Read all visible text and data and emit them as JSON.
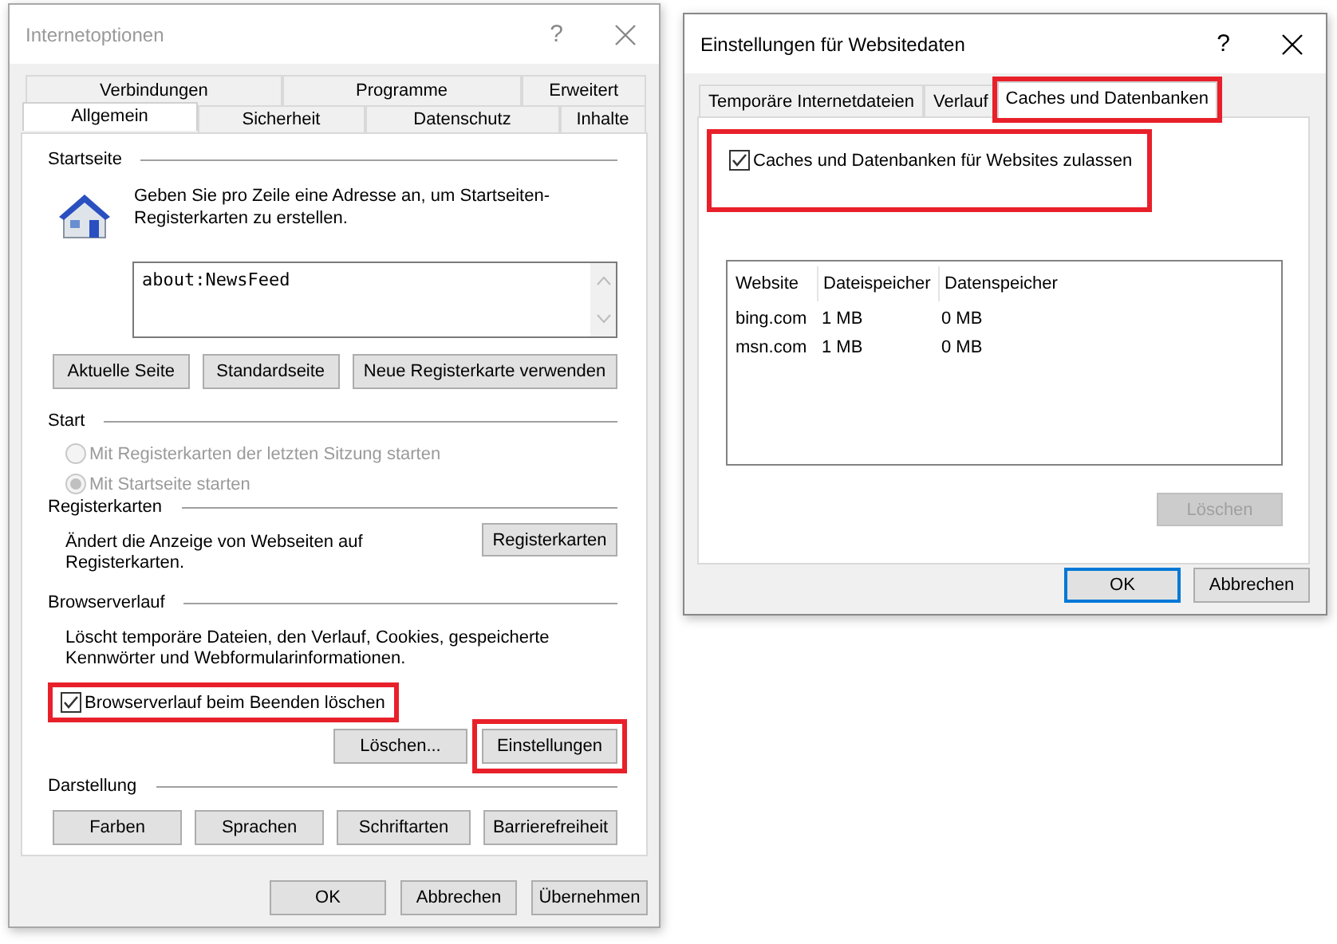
{
  "internet_options": {
    "title": "Internetoptionen",
    "help": "?",
    "tab_rows": [
      [
        {
          "label": "Verbindungen",
          "selected": false
        },
        {
          "label": "Programme",
          "selected": false
        },
        {
          "label": "Erweitert",
          "selected": false
        }
      ],
      [
        {
          "label": "Allgemein",
          "selected": true
        },
        {
          "label": "Sicherheit",
          "selected": false
        },
        {
          "label": "Datenschutz",
          "selected": false
        },
        {
          "label": "Inhalte",
          "selected": false
        }
      ]
    ],
    "startseite": {
      "heading": "Startseite",
      "description": "Geben Sie pro Zeile eine Adresse an, um Startseiten-Registerkarten zu erstellen.",
      "addresses": "about:NewsFeed",
      "buttons": [
        {
          "label": "Aktuelle Seite"
        },
        {
          "label": "Standardseite"
        },
        {
          "label": "Neue Registerkarte verwenden"
        }
      ]
    },
    "start": {
      "heading": "Start",
      "options": [
        {
          "label": "Mit Registerkarten der letzten Sitzung starten",
          "selected": false,
          "disabled": true
        },
        {
          "label": "Mit Startseite starten",
          "selected": true,
          "disabled": true
        }
      ]
    },
    "registerkarten": {
      "heading": "Registerkarten",
      "description": "Ändert die Anzeige von Webseiten auf Registerkarten.",
      "button": "Registerkarten"
    },
    "browserverlauf": {
      "heading": "Browserverlauf",
      "description": "Löscht temporäre Dateien, den Verlauf, Cookies, gespeicherte Kennwörter und Webformularinformationen.",
      "checkbox": {
        "label": "Browserverlauf beim Beenden löschen",
        "checked": true,
        "highlighted": true
      },
      "buttons": [
        {
          "label": "Löschen...",
          "highlighted": false
        },
        {
          "label": "Einstellungen",
          "highlighted": true
        }
      ]
    },
    "darstellung": {
      "heading": "Darstellung",
      "buttons": [
        {
          "label": "Farben"
        },
        {
          "label": "Sprachen"
        },
        {
          "label": "Schriftarten"
        },
        {
          "label": "Barrierefreiheit"
        }
      ]
    },
    "footer_buttons": [
      {
        "label": "OK",
        "default": false
      },
      {
        "label": "Abbrechen",
        "default": false
      },
      {
        "label": "Übernehmen",
        "default": false
      }
    ]
  },
  "website_data": {
    "title": "Einstellungen für Websitedaten",
    "help": "?",
    "tabs": [
      {
        "label": "Temporäre Internetdateien",
        "selected": false,
        "highlighted": false
      },
      {
        "label": "Verlauf",
        "selected": false,
        "highlighted": false
      },
      {
        "label": "Caches und Datenbanken",
        "selected": true,
        "highlighted": true
      }
    ],
    "checkbox": {
      "label": "Caches und Datenbanken für Websites zulassen",
      "checked": true,
      "highlighted": true
    },
    "table": {
      "columns": [
        "Website",
        "Dateispeicher",
        "Datenspeicher"
      ],
      "rows": [
        [
          "bing.com",
          "1 MB",
          "0 MB"
        ],
        [
          "msn.com",
          "1 MB",
          "0 MB"
        ]
      ]
    },
    "delete_button": {
      "label": "Löschen",
      "disabled": true
    },
    "footer_buttons": [
      {
        "label": "OK",
        "default": true
      },
      {
        "label": "Abbrechen",
        "default": false
      }
    ]
  }
}
